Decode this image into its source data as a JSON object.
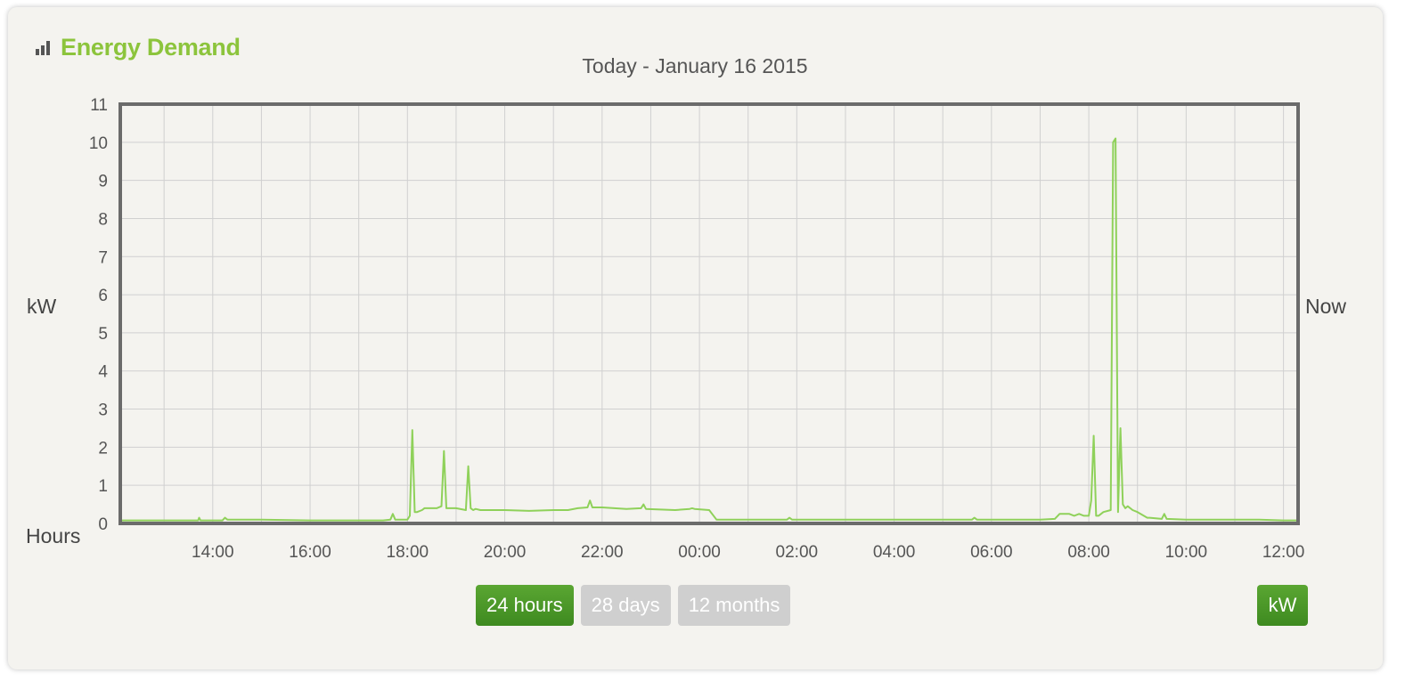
{
  "header": {
    "title": "Energy Demand",
    "icon": "bar-chart-icon"
  },
  "colors": {
    "accent": "#8cc43c",
    "line": "#8fd15a",
    "button_active": "#4a9a28",
    "button_inactive": "#cfcfcf",
    "grid": "#d0d0d0",
    "frame": "#6b6b6b"
  },
  "chart_data": {
    "type": "line",
    "title": "Today - January 16 2015",
    "ylabel": "kW",
    "xlabel": "Hours",
    "right_label": "Now",
    "ylim": [
      0,
      11
    ],
    "yticks": [
      "0",
      "1",
      "2",
      "3",
      "4",
      "5",
      "6",
      "7",
      "8",
      "9",
      "10",
      "11"
    ],
    "xlim": [
      12.1,
      36.3
    ],
    "xticks": [
      {
        "x": 14,
        "label": "14:00"
      },
      {
        "x": 16,
        "label": "16:00"
      },
      {
        "x": 18,
        "label": "18:00"
      },
      {
        "x": 20,
        "label": "20:00"
      },
      {
        "x": 22,
        "label": "22:00"
      },
      {
        "x": 24,
        "label": "00:00"
      },
      {
        "x": 26,
        "label": "02:00"
      },
      {
        "x": 28,
        "label": "04:00"
      },
      {
        "x": 30,
        "label": "06:00"
      },
      {
        "x": 32,
        "label": "08:00"
      },
      {
        "x": 34,
        "label": "10:00"
      },
      {
        "x": 36,
        "label": "12:00"
      }
    ],
    "grid": true,
    "series": [
      {
        "x": [
          12.1,
          13.0,
          13.7,
          13.72,
          13.75,
          14.2,
          14.25,
          14.3,
          15.0,
          16.0,
          17.0,
          17.5,
          17.65,
          17.7,
          17.75,
          18.0,
          18.05,
          18.1,
          18.15,
          18.2,
          18.3,
          18.35,
          18.6,
          18.7,
          18.75,
          18.8,
          18.9,
          19.0,
          19.2,
          19.25,
          19.3,
          19.35,
          19.4,
          19.5,
          20.0,
          20.5,
          21.0,
          21.3,
          21.5,
          21.7,
          21.75,
          21.8,
          22.0,
          22.5,
          22.8,
          22.85,
          22.9,
          23.5,
          23.8,
          23.85,
          23.9,
          24.2,
          24.35,
          25.0,
          25.8,
          25.85,
          25.9,
          27.0,
          28.0,
          29.0,
          29.6,
          29.65,
          29.7,
          30.5,
          31.0,
          31.3,
          31.4,
          31.6,
          31.7,
          31.8,
          31.9,
          32.0,
          32.05,
          32.1,
          32.15,
          32.2,
          32.3,
          32.45,
          32.5,
          32.55,
          32.6,
          32.65,
          32.7,
          32.75,
          32.8,
          32.9,
          33.0,
          33.2,
          33.25,
          33.5,
          33.55,
          33.6,
          34.0,
          35.0,
          35.5,
          36.0,
          36.3
        ],
        "y": [
          0.08,
          0.08,
          0.08,
          0.15,
          0.08,
          0.08,
          0.15,
          0.1,
          0.1,
          0.08,
          0.08,
          0.08,
          0.1,
          0.25,
          0.1,
          0.1,
          0.2,
          2.45,
          0.3,
          0.3,
          0.35,
          0.4,
          0.4,
          0.45,
          1.9,
          0.4,
          0.4,
          0.4,
          0.35,
          1.5,
          0.4,
          0.35,
          0.38,
          0.35,
          0.35,
          0.33,
          0.35,
          0.35,
          0.4,
          0.42,
          0.6,
          0.42,
          0.42,
          0.38,
          0.4,
          0.5,
          0.38,
          0.35,
          0.38,
          0.4,
          0.38,
          0.35,
          0.1,
          0.1,
          0.1,
          0.15,
          0.1,
          0.1,
          0.1,
          0.1,
          0.1,
          0.15,
          0.1,
          0.1,
          0.1,
          0.12,
          0.25,
          0.25,
          0.2,
          0.25,
          0.2,
          0.2,
          0.6,
          2.3,
          0.2,
          0.2,
          0.3,
          0.35,
          10.0,
          10.1,
          0.3,
          2.5,
          0.5,
          0.4,
          0.45,
          0.35,
          0.3,
          0.15,
          0.15,
          0.12,
          0.25,
          0.12,
          0.1,
          0.1,
          0.1,
          0.08,
          0.08
        ]
      }
    ]
  },
  "buttons": {
    "range_24h": "24 hours",
    "range_28d": "28 days",
    "range_12m": "12 months",
    "unit_kw": "kW"
  }
}
